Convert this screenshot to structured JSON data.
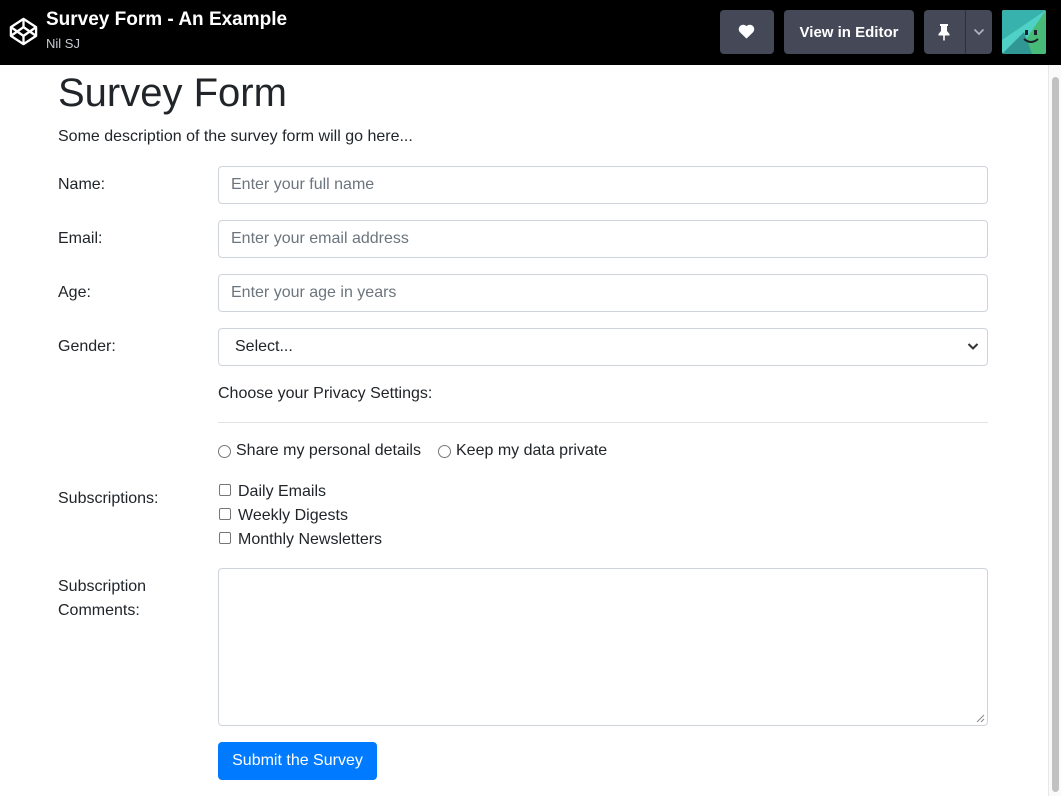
{
  "header": {
    "pen_title": "Survey Form - An Example",
    "author": "Nil SJ",
    "heart_icon": "heart-icon",
    "view_in_editor_label": "View in Editor",
    "pin_icon": "pin-icon",
    "caret_icon": "chevron-down-icon",
    "logo_icon": "codepen-logo",
    "avatar_icon": "user-avatar"
  },
  "form": {
    "title": "Survey Form",
    "description": "Some description of the survey form will go here...",
    "name": {
      "label": "Name:",
      "placeholder": "Enter your full name"
    },
    "email": {
      "label": "Email:",
      "placeholder": "Enter your email address"
    },
    "age": {
      "label": "Age:",
      "placeholder": "Enter your age in years"
    },
    "gender": {
      "label": "Gender:",
      "selected": "Select..."
    },
    "privacy": {
      "heading": "Choose your Privacy Settings:",
      "options": [
        "Share my personal details",
        "Keep my data private"
      ]
    },
    "subscriptions": {
      "label": "Subscriptions:",
      "options": [
        "Daily Emails",
        "Weekly Digests",
        "Monthly Newsletters"
      ]
    },
    "comments": {
      "label_line1": "Subscription",
      "label_line2": "Comments:"
    },
    "submit_label": "Submit the Survey"
  },
  "colors": {
    "topbar_bg": "#000000",
    "dark_button": "#444857",
    "primary": "#007bff",
    "input_border": "#ced4da"
  }
}
